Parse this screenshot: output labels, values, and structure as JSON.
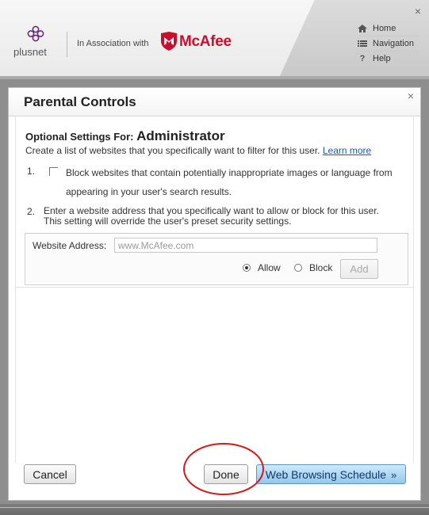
{
  "header": {
    "brand": "plusnet",
    "association": "In Association with",
    "partner": "McAfee",
    "close_glyph": "×",
    "nav": [
      {
        "label": "Home",
        "icon": "home-icon"
      },
      {
        "label": "Navigation",
        "icon": "list-icon"
      },
      {
        "label": "Help",
        "icon": "help-icon"
      }
    ],
    "help_glyph": "?"
  },
  "dialog": {
    "title": "Parental Controls",
    "close_glyph": "×",
    "heading_prefix": "Optional Settings For:",
    "user_name": "Administrator",
    "description": "Create a list of websites that you specifically want to filter for this user.",
    "learn_more": "Learn more",
    "item1_num": "1.",
    "item1_text": "Block websites that contain potentially inappropriate images or language from appearing in your user's search results.",
    "item2_num": "2.",
    "item2_line1": "Enter a website address that you specifically want to allow or block for this user.",
    "item2_line2": "This setting will override the user's preset security settings.",
    "address_label": "Website Address:",
    "address_placeholder": "www.McAfee.com",
    "address_value": "",
    "allow_label": "Allow",
    "block_label": "Block",
    "allow_selected": true,
    "add_label": "Add",
    "cancel_label": "Cancel",
    "done_label": "Done",
    "schedule_label": "Web Browsing Schedule",
    "schedule_chevron": "»"
  },
  "colors": {
    "mcafee_red": "#c8102e",
    "plusnet_purple": "#6b2c7a",
    "link_blue": "#1a5bb5",
    "annotation_red": "#d61919",
    "schedule_button": "#93c8ec"
  }
}
